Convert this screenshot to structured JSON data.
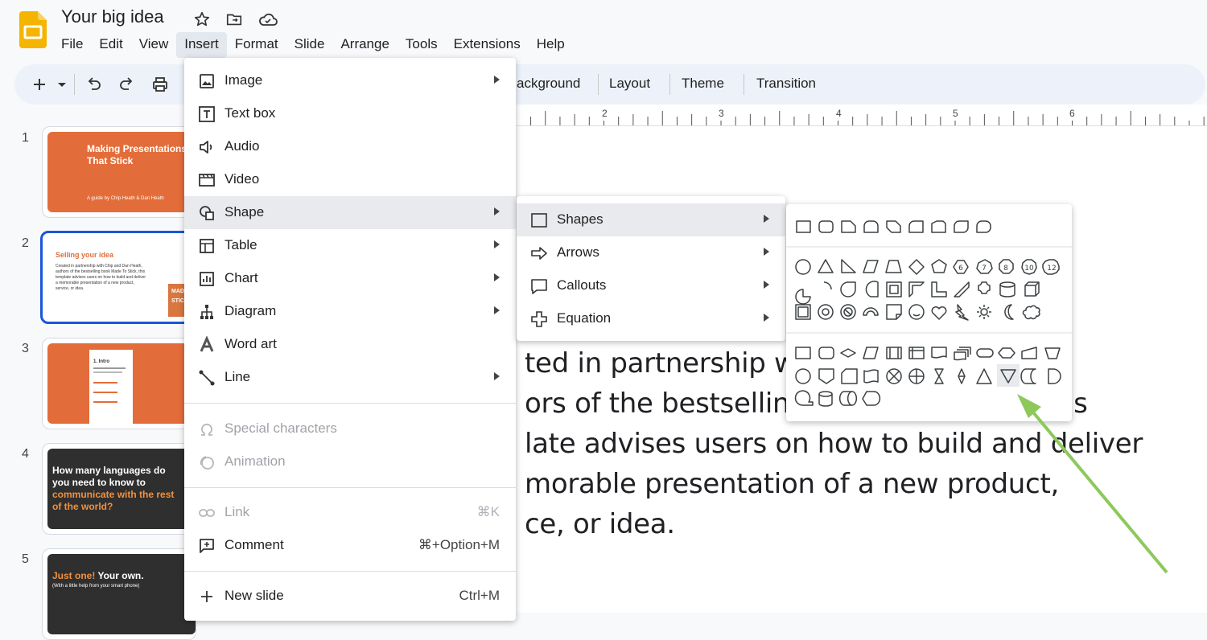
{
  "header": {
    "doc_title": "Your big idea",
    "menus": [
      "File",
      "Edit",
      "View",
      "Insert",
      "Format",
      "Slide",
      "Arrange",
      "Tools",
      "Extensions",
      "Help"
    ]
  },
  "toolbar": {
    "background_label": "ackground",
    "layout_label": "Layout",
    "theme_label": "Theme",
    "transition_label": "Transition"
  },
  "ruler": {
    "numbers": [
      "2",
      "3",
      "4",
      "5",
      "6"
    ]
  },
  "slide_text": [
    "ted in partnership wit",
    "ors of the bestselling b",
    "late advises users on how to build and deliver",
    "morable presentation of a new product,",
    "ce, or idea."
  ],
  "slide_text_right_fragment": "is",
  "thumbnails": {
    "numbers": [
      "1",
      "2",
      "3",
      "4",
      "5"
    ],
    "s1": {
      "title": "Making Presentations That Stick",
      "subtitle": "A guide by Chip Heath & Dan Heath"
    },
    "s2": {
      "title": "Selling your idea",
      "body": "Created in partnership with Chip and Dan Heath, authors of the bestselling book Made To Stick, this template advises users on how to build and deliver a memorable presentation of a new product, service, or idea.",
      "badge": "MADE STICK"
    },
    "s3": {
      "title": "1. Intro"
    },
    "s4": {
      "title_a": "How many languages do you need to know to ",
      "title_b": "communicate with the rest of the world?"
    },
    "s5": {
      "title_a": "Just one!",
      "title_b": " Your own.",
      "subtitle": "(With a little help from your smart phone)"
    }
  },
  "insert_menu": {
    "items": [
      {
        "label": "Image",
        "icon": "image-icon",
        "submenu": true
      },
      {
        "label": "Text box",
        "icon": "text-box-icon",
        "submenu": false
      },
      {
        "label": "Audio",
        "icon": "audio-icon",
        "submenu": false
      },
      {
        "label": "Video",
        "icon": "video-icon",
        "submenu": false
      },
      {
        "label": "Shape",
        "icon": "shape-icon",
        "submenu": true
      },
      {
        "label": "Table",
        "icon": "table-icon",
        "submenu": true
      },
      {
        "label": "Chart",
        "icon": "chart-icon",
        "submenu": true
      },
      {
        "label": "Diagram",
        "icon": "diagram-icon",
        "submenu": true
      },
      {
        "label": "Word art",
        "icon": "word-art-icon",
        "submenu": false
      },
      {
        "label": "Line",
        "icon": "line-icon",
        "submenu": true
      },
      {
        "label": "Special characters",
        "icon": "omega-icon",
        "disabled": true
      },
      {
        "label": "Animation",
        "icon": "animation-icon",
        "disabled": true
      },
      {
        "label": "Link",
        "icon": "link-icon",
        "disabled": true,
        "shortcut": "⌘K"
      },
      {
        "label": "Comment",
        "icon": "comment-icon",
        "shortcut": "⌘+Option+M"
      },
      {
        "label": "New slide",
        "icon": "plus-icon",
        "shortcut": "Ctrl+M"
      }
    ]
  },
  "shape_submenu": {
    "items": [
      {
        "label": "Shapes",
        "icon": "square-outline-icon"
      },
      {
        "label": "Arrows",
        "icon": "arrow-right-outline-icon"
      },
      {
        "label": "Callouts",
        "icon": "callout-icon"
      },
      {
        "label": "Equation",
        "icon": "plus-outline-icon"
      }
    ]
  },
  "shape_gallery": {
    "hovered_shape": "flowchart-merge",
    "row_numbers": [
      "6",
      "7",
      "8",
      "10",
      "12"
    ]
  },
  "colors": {
    "accent": "#1a56db",
    "slide_orange": "#e36d3a",
    "slide_dark": "#2f2f2f",
    "annotation_arrow": "#8dc95a",
    "logo_yellow": "#f4b400"
  }
}
